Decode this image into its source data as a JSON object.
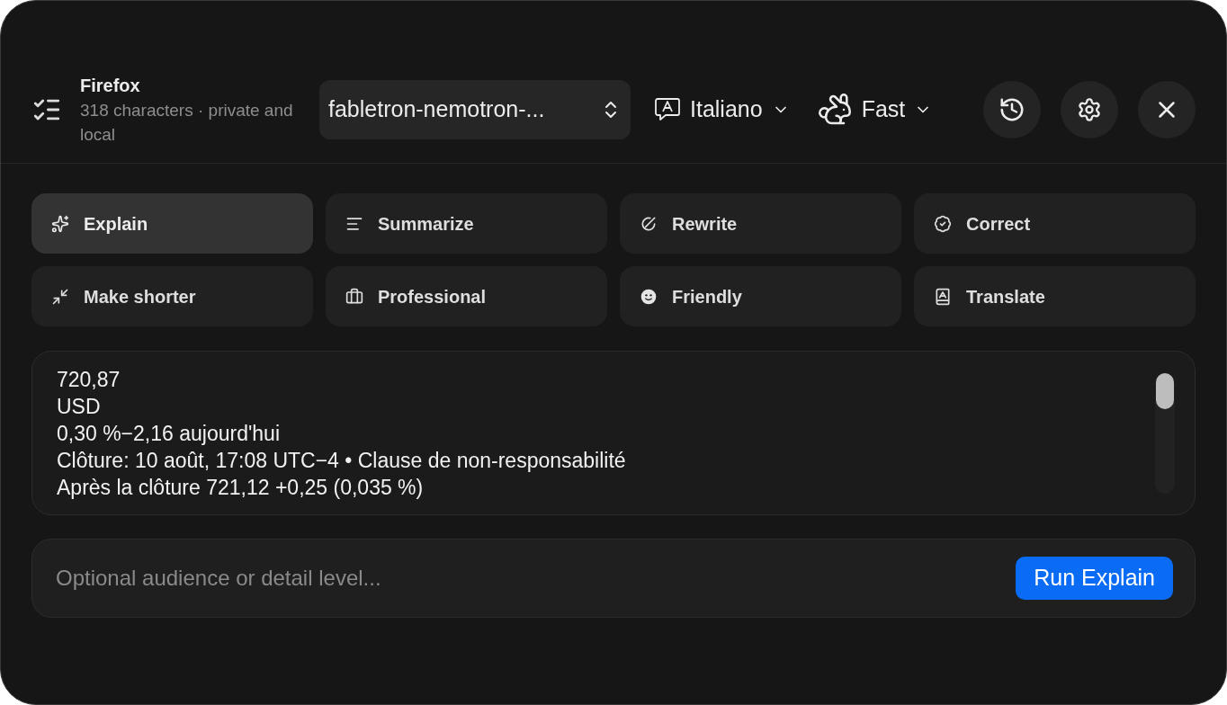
{
  "header": {
    "title": "Firefox",
    "subtitle": "318 characters · private and local"
  },
  "model_select": {
    "value": "fabletron-nemotron-..."
  },
  "language_menu": {
    "label": "Italiano"
  },
  "speed_menu": {
    "label": "Fast"
  },
  "actions": [
    {
      "label": "Explain",
      "selected": true
    },
    {
      "label": "Summarize",
      "selected": false
    },
    {
      "label": "Rewrite",
      "selected": false
    },
    {
      "label": "Correct",
      "selected": false
    },
    {
      "label": "Make shorter",
      "selected": false
    },
    {
      "label": "Professional",
      "selected": false
    },
    {
      "label": "Friendly",
      "selected": false
    },
    {
      "label": "Translate",
      "selected": false
    }
  ],
  "source_text": "720,87\nUSD\n0,30 %−2,16 aujourd'hui\nClôture: 10 août, 17:08 UTC−4 • Clause de non-responsabilité\nAprès la clôture 721,12 +0,25 (0,035 %)",
  "instructions": {
    "placeholder": "Optional audience or detail level..."
  },
  "run_button": {
    "label": "Run Explain"
  }
}
